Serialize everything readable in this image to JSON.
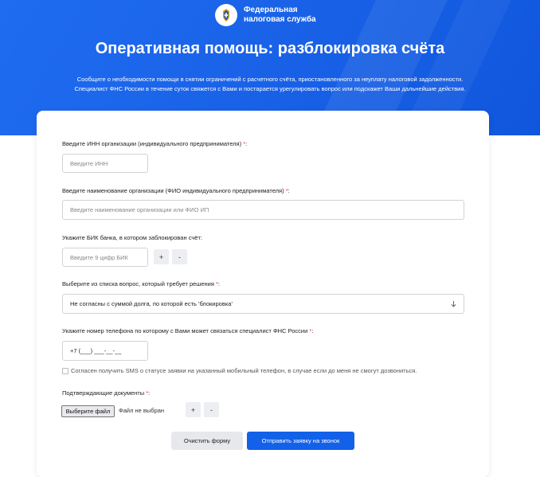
{
  "header": {
    "logo_line1": "Федеральная",
    "logo_line2": "налоговая служба",
    "title": "Оперативная помощь: разблокировка счёта",
    "subtitle_line1": "Сообщите о необходимости помощи в снятии ограничений с расчетного счёта, приостановленного за неуплату налоговой задолженности.",
    "subtitle_line2": "Специалист ФНС России в течение суток свяжется с Вами и постарается урегулировать вопрос или подскажет Ваши дальнейшие действия."
  },
  "form": {
    "required_mark": "*",
    "inn": {
      "label": "Введите ИНН организации (индивидуального предпринимателя)",
      "placeholder": "Введите ИНН"
    },
    "name": {
      "label": "Введите наименование организации (ФИО индивидуального предпринимателя)",
      "placeholder": "Введите наименование организации или ФИО ИП"
    },
    "bik": {
      "label": "Укажите БИК банка, в котором заблокирован счёт:",
      "placeholder": "Введите 9 цифр БИК",
      "add": "+",
      "remove": "-"
    },
    "question": {
      "label": "Выберите из списка вопрос, который требует решения",
      "selected": "Не согласны с суммой долга, по которой есть 'блокировка'"
    },
    "phone": {
      "label": "Укажите номер телефона по которому с Вами может связаться специалист ФНС России",
      "value": "+7 (___) ___-__-__"
    },
    "sms_consent": "Согласен получить SMS о статусе заявки на указанный мобильный телефон, в случае если до меня не смогут дозвониться.",
    "docs": {
      "label": "Подтверждающие документы",
      "choose_file": "Выберите файл",
      "no_file": "Файл не выбран",
      "add": "+",
      "remove": "-"
    },
    "clear_button": "Очистить форму",
    "submit_button": "Отправить заявку на звонок"
  },
  "colors": {
    "brand_blue": "#1361e8",
    "required": "#e53935"
  },
  "icons": {
    "emblem": "fns-emblem-icon",
    "select": "chevron-down-icon"
  }
}
